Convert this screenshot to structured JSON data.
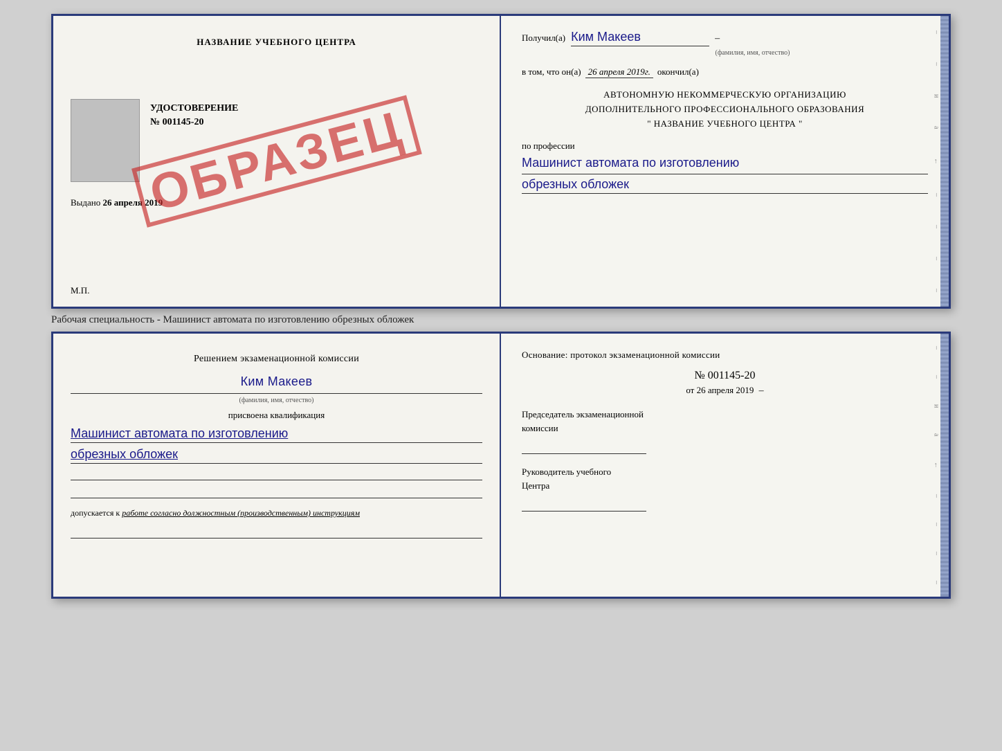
{
  "top_document": {
    "left": {
      "title": "НАЗВАНИЕ УЧЕБНОГО ЦЕНТРА",
      "udostoverenie_label": "УДОСТОВЕРЕНИЕ",
      "number": "№ 001145-20",
      "vydano_label": "Выдано",
      "vydano_date": "26 апреля 2019",
      "mp_label": "М.П.",
      "obrazec": "ОБРАЗЕЦ"
    },
    "right": {
      "poluchil_label": "Получил(a)",
      "poluchil_name": "Ким Макеев",
      "dash": "–",
      "fio_label": "(фамилия, имя, отчество)",
      "vtom_label": "в том, что он(а)",
      "vtom_date": "26 апреля 2019г.",
      "okonchil_label": "окончил(а)",
      "org_line1": "АВТОНОМНУЮ НЕКОММЕРЧЕСКУЮ ОРГАНИЗАЦИЮ",
      "org_line2": "ДОПОЛНИТЕЛЬНОГО ПРОФЕССИОНАЛЬНОГО ОБРАЗОВАНИЯ",
      "org_name": "\"  НАЗВАНИЕ УЧЕБНОГО ЦЕНТРА  \"",
      "po_professii": "по профессии",
      "profession_line1": "Машинист автомата по изготовлению",
      "profession_line2": "обрезных обложек"
    }
  },
  "caption": "Рабочая специальность - Машинист автомата по изготовлению обрезных обложек",
  "bottom_document": {
    "left": {
      "resheniyem_label": "Решением экзаменационной комиссии",
      "name": "Ким Макеев",
      "fio_label": "(фамилия, имя, отчество)",
      "prisvoena_label": "присвоена квалификация",
      "kvalif_line1": "Машинист автомата по изготовлению",
      "kvalif_line2": "обрезных обложек",
      "dopuskaetsya_label": "допускается к",
      "dopuskaetsya_text": "работе согласно должностным (производственным) инструкциям"
    },
    "right": {
      "osnovanie_label": "Основание: протокол экзаменационной комиссии",
      "number": "№  001145-20",
      "ot_label": "от",
      "ot_date": "26 апреля 2019",
      "predsedatel_line1": "Председатель экзаменационной",
      "predsedatel_line2": "комиссии",
      "rukovoditel_line1": "Руководитель учебного",
      "rukovoditel_line2": "Центра"
    }
  }
}
